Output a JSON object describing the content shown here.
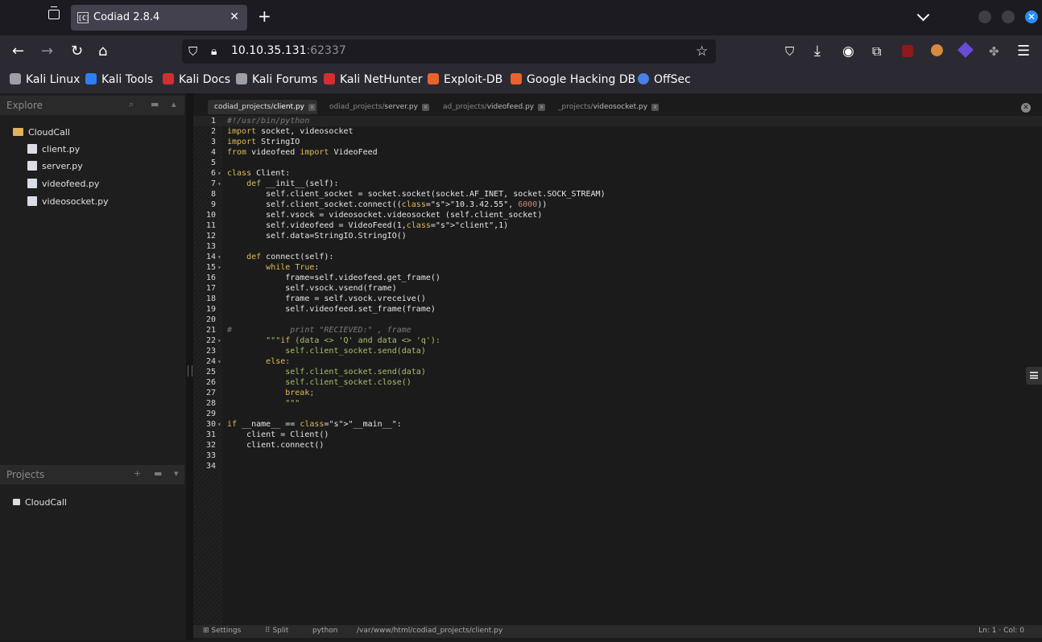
{
  "browser": {
    "tab_title": "Codiad 2.8.4",
    "tab_favicon": "[C]",
    "new_tab": "+",
    "url_host": "10.10.35.131",
    "url_port": ":62337",
    "bookmarks": [
      "Kali Linux",
      "Kali Tools",
      "Kali Docs",
      "Kali Forums",
      "Kali NetHunter",
      "Exploit-DB",
      "Google Hacking DB",
      "OffSec"
    ],
    "bookmark_colors": [
      "#9aa0a6",
      "#2d7ff9",
      "#d32f2f",
      "#9aa0a6",
      "#d32f2f",
      "#e8632b",
      "#e8632b",
      "#4a7fe8"
    ]
  },
  "sidebar": {
    "explore_title": "Explore",
    "root_folder": "CloudCall",
    "files": [
      "client.py",
      "server.py",
      "videofeed.py",
      "videosocket.py"
    ],
    "projects_title": "Projects",
    "projects": [
      "CloudCall"
    ]
  },
  "editor": {
    "tabs": [
      {
        "prefix": "codiad_projects/",
        "name": "client.py"
      },
      {
        "prefix": "odiad_projects/",
        "name": "server.py"
      },
      {
        "prefix": "ad_projects/",
        "name": "videofeed.py"
      },
      {
        "prefix": "_projects/",
        "name": "videosocket.py"
      }
    ],
    "close_label": "x",
    "lines": [
      "#!/usr/bin/python",
      "import socket, videosocket",
      "import StringIO",
      "from videofeed import VideoFeed",
      "",
      "class Client:",
      "    def __init__(self):",
      "        self.client_socket = socket.socket(socket.AF_INET, socket.SOCK_STREAM)",
      "        self.client_socket.connect((\"10.3.42.55\", 6000))",
      "        self.vsock = videosocket.videosocket (self.client_socket)",
      "        self.videofeed = VideoFeed(1,\"client\",1)",
      "        self.data=StringIO.StringIO()",
      "",
      "    def connect(self):",
      "        while True:",
      "            frame=self.videofeed.get_frame()",
      "            self.vsock.vsend(frame)",
      "            frame = self.vsock.vreceive()",
      "            self.videofeed.set_frame(frame)",
      "",
      "#            print \"RECIEVED:\" , frame",
      "        \"\"\"if (data <> 'Q' and data <> 'q'):",
      "            self.client_socket.send(data)",
      "        else:",
      "            self.client_socket.send(data)",
      "            self.client_socket.close()",
      "            break;",
      "            \"\"\"",
      "",
      "if __name__ == \"__main__\":",
      "    client = Client()",
      "    client.connect()",
      "",
      ""
    ]
  },
  "status": {
    "settings": "Settings",
    "split": "Split",
    "mode": "python",
    "path": "/var/www/html/codiad_projects/client.py",
    "cursor": "Ln: 1 · Col: 0"
  }
}
